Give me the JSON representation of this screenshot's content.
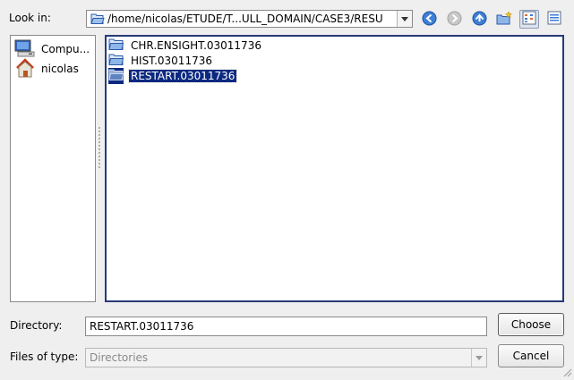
{
  "look_in": {
    "label": "Look in:",
    "path": "/home/nicolas/ETUDE/T...ULL_DOMAIN/CASE3/RESU"
  },
  "toolbar": {
    "icons": [
      "back-icon",
      "forward-icon",
      "parent-directory-icon",
      "new-folder-icon",
      "list-view-icon",
      "detail-view-icon"
    ]
  },
  "sidebar": {
    "items": [
      {
        "label": "Compu...",
        "icon": "computer-icon"
      },
      {
        "label": "nicolas",
        "icon": "home-icon"
      }
    ]
  },
  "files": [
    {
      "name": "CHR.ENSIGHT.03011736",
      "selected": false
    },
    {
      "name": "HIST.03011736",
      "selected": false
    },
    {
      "name": "RESTART.03011736",
      "selected": true
    }
  ],
  "directory": {
    "label": "Directory:",
    "value": "RESTART.03011736"
  },
  "file_types": {
    "label": "Files of type:",
    "value": "Directories"
  },
  "buttons": {
    "choose": "Choose",
    "cancel": "Cancel"
  },
  "colors": {
    "selection": "#0b2980",
    "focus_border": "#273a78",
    "window_bg": "#efefef"
  }
}
